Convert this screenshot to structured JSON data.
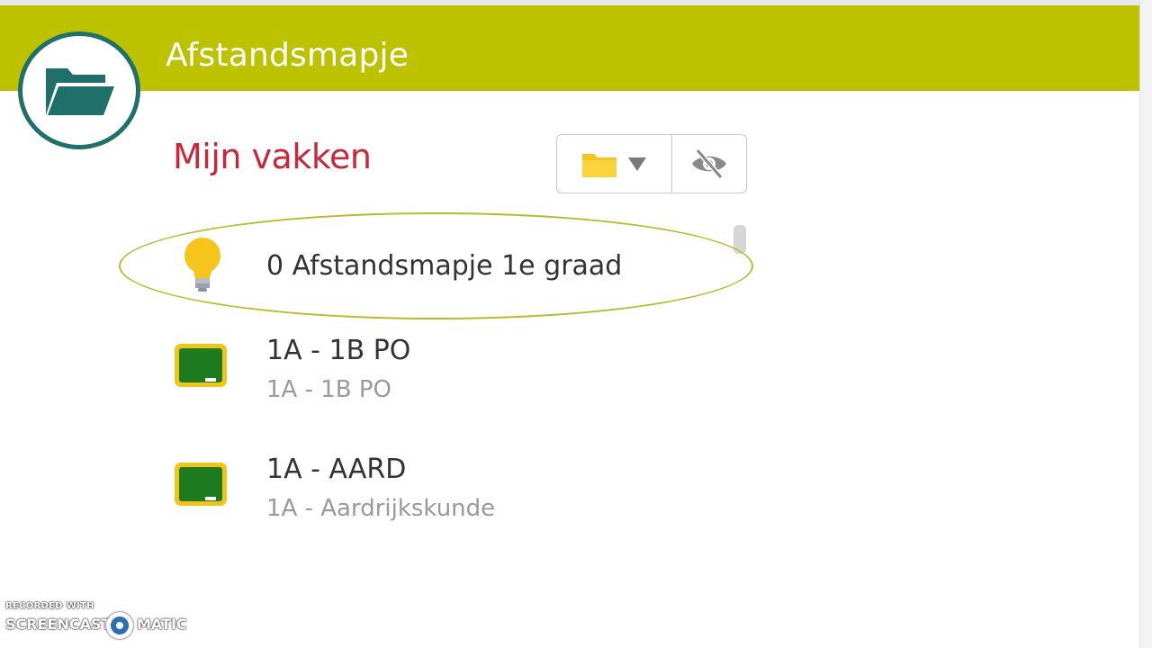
{
  "header": {
    "title": "Afstandsmapje",
    "bar_color": "#bcc200",
    "app_icon": "folder-open-icon"
  },
  "section": {
    "title": "Mijn vakken",
    "title_color": "#c8283c"
  },
  "toolbar": {
    "folder_button_icon": "folder-icon",
    "dropdown_icon": "caret-down-icon",
    "hide_button_icon": "eye-slash-icon"
  },
  "items": [
    {
      "icon": "lightbulb-icon",
      "title": "0 Afstandsmapje 1e graad",
      "subtitle": "",
      "highlighted": true
    },
    {
      "icon": "chalkboard-icon",
      "title": "1A - 1B PO",
      "subtitle": "1A - 1B PO"
    },
    {
      "icon": "chalkboard-icon",
      "title": "1A - AARD",
      "subtitle": "1A - Aardrijkskunde"
    }
  ],
  "watermark": {
    "small": "RECORDED WITH",
    "left": "SCREENCAST",
    "right": "MATIC"
  }
}
